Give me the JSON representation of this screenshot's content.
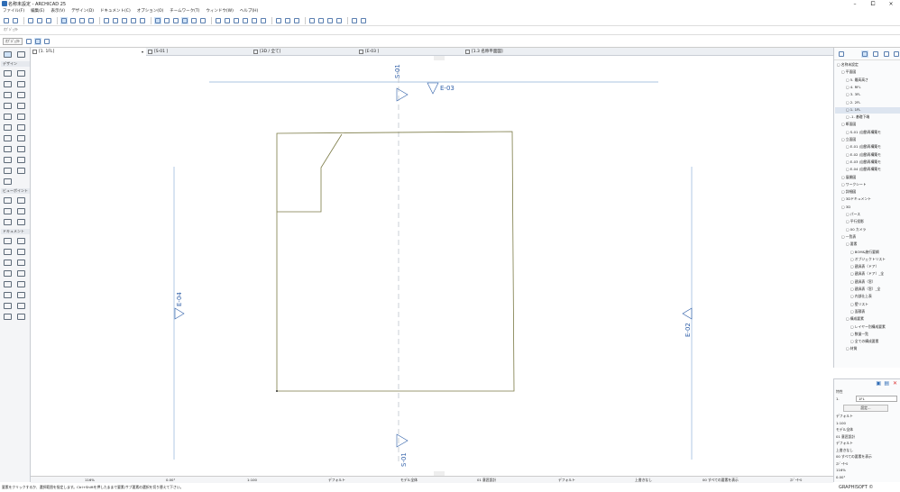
{
  "window": {
    "title": "名称未設定 - ARCHICAD 25",
    "controls": [
      "–",
      "⧠",
      "×"
    ]
  },
  "menu": [
    "ファイル(F)",
    "編集(E)",
    "表示(V)",
    "デザイン(D)",
    "ドキュメント(C)",
    "オプション(O)",
    "チームワーク(T)",
    "ウィンドウ(W)",
    "ヘルプ(H)"
  ],
  "toolbar2": {
    "label": "ｵﾌﾞｼﾞｪｸﾄ"
  },
  "toolbar3": {
    "layer": "ｵﾌﾞｼﾞｪｸﾄ"
  },
  "tabs": [
    {
      "label": "[1. 1FL]",
      "active": true
    },
    {
      "label": "[S-01 ]"
    },
    {
      "label": "[3D / 全て]"
    },
    {
      "label": "[E-03 ]"
    },
    {
      "label": "[1.3 名称平面図]"
    }
  ],
  "left_sections": {
    "design": "デザイン",
    "viewpoint": "ビューポイント",
    "document": "ドキュメント"
  },
  "markers": {
    "s01_top": "S-01",
    "s01_bottom": "S-01",
    "e03": "E-03",
    "e04": "E-04",
    "e02": "E-02"
  },
  "navigator": [
    {
      "label": "名称未設定",
      "indent": 0
    },
    {
      "label": "平面図",
      "indent": 1
    },
    {
      "label": "5. 最高高さ",
      "indent": 2
    },
    {
      "label": "4. RFL",
      "indent": 2
    },
    {
      "label": "3. 3FL",
      "indent": 2
    },
    {
      "label": "2. 2FL",
      "indent": 2
    },
    {
      "label": "1. 1FL",
      "indent": 2,
      "selected": true
    },
    {
      "label": "-1. 基礎下端",
      "indent": 2
    },
    {
      "label": "断面図",
      "indent": 1
    },
    {
      "label": "S-01 (自動再構築モ",
      "indent": 2
    },
    {
      "label": "立面図",
      "indent": 1
    },
    {
      "label": "E-01 (自動再構築モ",
      "indent": 2
    },
    {
      "label": "E-02 (自動再構築モ",
      "indent": 2
    },
    {
      "label": "E-03 (自動再構築モ",
      "indent": 2
    },
    {
      "label": "E-04 (自動再構築モ",
      "indent": 2
    },
    {
      "label": "展開図",
      "indent": 1
    },
    {
      "label": "ワークシート",
      "indent": 1
    },
    {
      "label": "詳細図",
      "indent": 1
    },
    {
      "label": "3Dドキュメント",
      "indent": 1
    },
    {
      "label": "3D",
      "indent": 1
    },
    {
      "label": "パース",
      "indent": 2
    },
    {
      "label": "平行投影",
      "indent": 2
    },
    {
      "label": "00 カメラ",
      "indent": 2
    },
    {
      "label": "一覧表",
      "indent": 1
    },
    {
      "label": "要素",
      "indent": 2
    },
    {
      "label": "BOM&施行要綱",
      "indent": 3
    },
    {
      "label": "オブジェクトリスト",
      "indent": 3
    },
    {
      "label": "建具表（ドア）",
      "indent": 3
    },
    {
      "label": "建具表（ドア）_全",
      "indent": 3
    },
    {
      "label": "建具表（窓）",
      "indent": 3
    },
    {
      "label": "建具表（窓）_全",
      "indent": 3
    },
    {
      "label": "内部仕上表",
      "indent": 3
    },
    {
      "label": "壁リスト",
      "indent": 3
    },
    {
      "label": "面積表",
      "indent": 3
    },
    {
      "label": "構成要素",
      "indent": 2
    },
    {
      "label": "レイヤー別構成要素",
      "indent": 3
    },
    {
      "label": "数量一覧",
      "indent": 3
    },
    {
      "label": "全ての構成要素",
      "indent": 3
    },
    {
      "label": "材質",
      "indent": 2
    }
  ],
  "properties": {
    "header": "特性",
    "story_num": "1.",
    "story_name": "1FL",
    "settings": "設定...",
    "rows": [
      "デフォルト",
      "1:100",
      "モデル全体",
      "01 意匠設計",
      "デフォルト",
      "上書きなし",
      "00 すべての要素を表示",
      "ｽｼﾞｰﾁｰﾙ",
      "116%",
      "0.00°"
    ]
  },
  "status": {
    "zoom": "116%",
    "angle": "0.00°",
    "scale": "1:100",
    "pen": "デフォルト",
    "model": "モデル全体",
    "layer": "01 意匠設計",
    "dim": "デフォルト",
    "override": "上書きなし",
    "reno": "00 すべての要素を表示",
    "struct": "ｽｼﾞｰﾁｰﾙ"
  },
  "hint": "要素をクリックするか、選択範囲を指定します。Ctrl+Shiftを押したままで要素/サブ要素の選択を切り替えて下さい。",
  "brand": "GRAPHISOFT ©",
  "colors": {
    "wall": "#7b7a45",
    "marker": "#2f5fa8",
    "accent": "#cfe2f7"
  }
}
